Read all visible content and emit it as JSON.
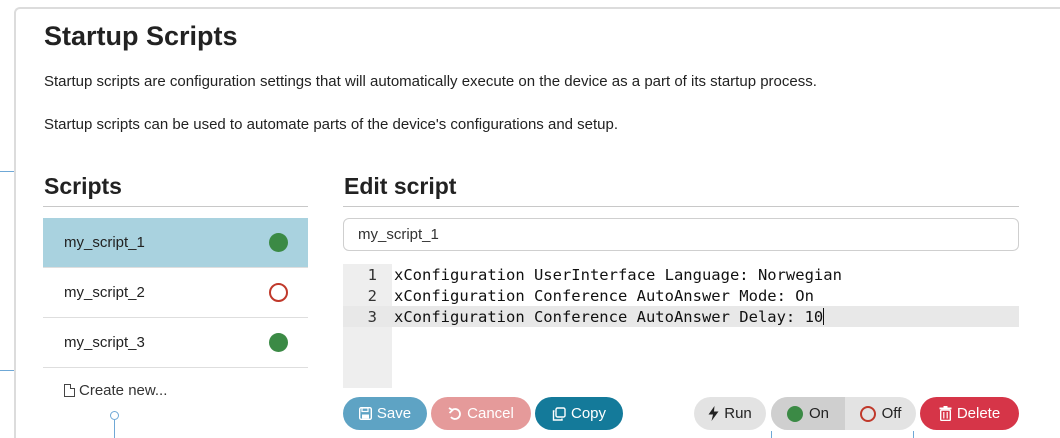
{
  "page": {
    "title": "Startup Scripts",
    "description_1": "Startup scripts are configuration settings that will automatically execute on the device as a part of its startup process.",
    "description_2": "Startup scripts can be used to automate parts of the device's configurations and setup."
  },
  "scripts": {
    "heading": "Scripts",
    "items": [
      {
        "name": "my_script_1",
        "status": "on",
        "selected": true
      },
      {
        "name": "my_script_2",
        "status": "off",
        "selected": false
      },
      {
        "name": "my_script_3",
        "status": "on",
        "selected": false
      }
    ],
    "create_new_label": "Create new..."
  },
  "editor": {
    "heading": "Edit script",
    "script_name_value": "my_script_1",
    "lines": [
      {
        "number": "1",
        "text": "xConfiguration UserInterface Language: Norwegian"
      },
      {
        "number": "2",
        "text": "xConfiguration Conference AutoAnswer Mode: On"
      },
      {
        "number": "3",
        "text": "xConfiguration Conference AutoAnswer Delay: 10"
      }
    ],
    "active_line": 3
  },
  "actions": {
    "save_label": "Save",
    "cancel_label": "Cancel",
    "copy_label": "Copy",
    "run_label": "Run",
    "on_label": "On",
    "off_label": "Off",
    "delete_label": "Delete"
  },
  "icons": {
    "save": "floppy-disk-icon",
    "cancel": "undo-icon",
    "copy": "copy-icon",
    "run": "lightning-icon",
    "delete": "trash-icon",
    "create_new": "document-icon"
  },
  "colors": {
    "selected_row": "#a9d2df",
    "status_on": "#3b8a45",
    "status_off": "#c0392b",
    "save": "#5ea3c4",
    "cancel": "#e59a9a",
    "copy": "#147a9a",
    "delete": "#d63548"
  }
}
